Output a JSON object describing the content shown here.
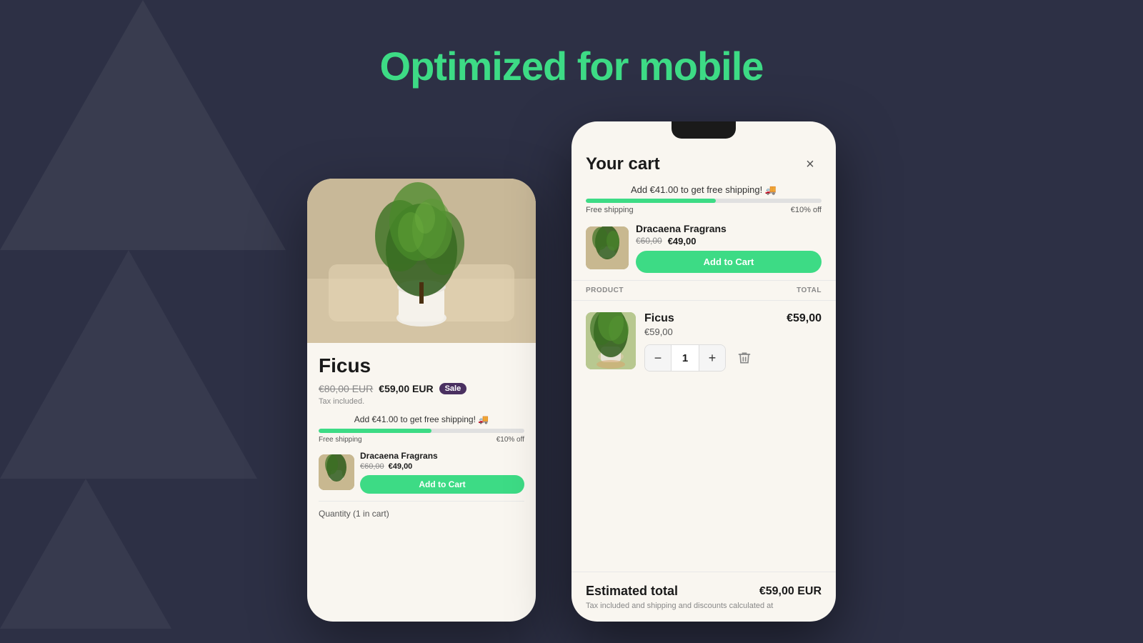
{
  "page": {
    "title": "Optimized for mobile",
    "bg_color": "#2d3045",
    "accent_color": "#3ddb85"
  },
  "phone_left": {
    "product": {
      "name": "Ficus",
      "original_price": "€80,00 EUR",
      "sale_price": "€59,00 EUR",
      "sale_badge": "Sale",
      "tax_info": "Tax included.",
      "shipping_msg": "Add €41.00 to get free shipping! 🚚",
      "free_shipping_label": "Free shipping",
      "discount_label": "€10% off",
      "progress_fill_pct": "55%"
    },
    "upsell": {
      "name": "Dracaena Fragrans",
      "old_price": "€60,00",
      "new_price": "€49,00",
      "add_to_cart": "Add to Cart"
    },
    "quantity": {
      "label": "Quantity (1 in cart)"
    }
  },
  "phone_right": {
    "header": {
      "title": "Your cart",
      "close_label": "×"
    },
    "shipping": {
      "msg": "Add €41.00 to get free shipping! 🚚",
      "free_label": "Free shipping",
      "discount_label": "€10% off",
      "progress_fill_pct": "55%"
    },
    "upsell": {
      "name": "Dracaena Fragrans",
      "old_price": "€60,00",
      "new_price": "€49,00",
      "add_to_cart": "Add to Cart"
    },
    "table": {
      "col_product": "PRODUCT",
      "col_total": "TOTAL"
    },
    "cart_item": {
      "name": "Ficus",
      "unit_price": "€59,00",
      "quantity": "1",
      "total": "€59,00"
    },
    "footer": {
      "estimated_label": "Estimated total",
      "estimated_value": "€59,00 EUR",
      "tax_note": "Tax included and shipping and discounts calculated at"
    }
  }
}
